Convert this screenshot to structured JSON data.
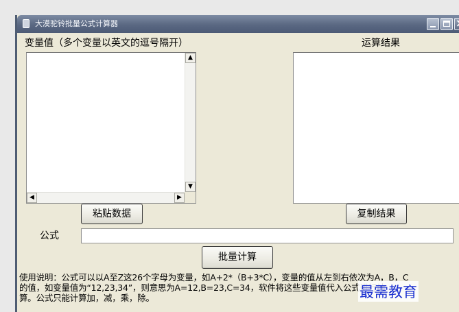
{
  "window": {
    "title": "大漠驼铃批量公式计算器",
    "controls": {
      "minimize": "minimize",
      "maximize": "maximize",
      "close": "close"
    }
  },
  "labels": {
    "variables": "变量值（多个变量以英文的逗号隔开）",
    "result": "运算结果",
    "formula": "公式"
  },
  "variables_input": {
    "value": ""
  },
  "result_output": {
    "value": ""
  },
  "formula_input": {
    "value": ""
  },
  "buttons": {
    "paste": "粘贴数据",
    "copy": "复制结果",
    "calculate": "批量计算"
  },
  "instructions": "使用说明：公式可以以A至Z这26个字母为变量，如A+2*（B+3*C），变量的值从左到右依次为A，B，C\n的值，如变量值为“12,23,34”，则意思为A=12,B=23,C=34，软件将这些变量值代入公式进行计\n算。公式只能计算加，减，乘，除。",
  "watermark": "最需教育",
  "scroll_glyphs": {
    "up": "▲",
    "down": "▼",
    "left": "◀",
    "right": "▶",
    "close": "×"
  }
}
